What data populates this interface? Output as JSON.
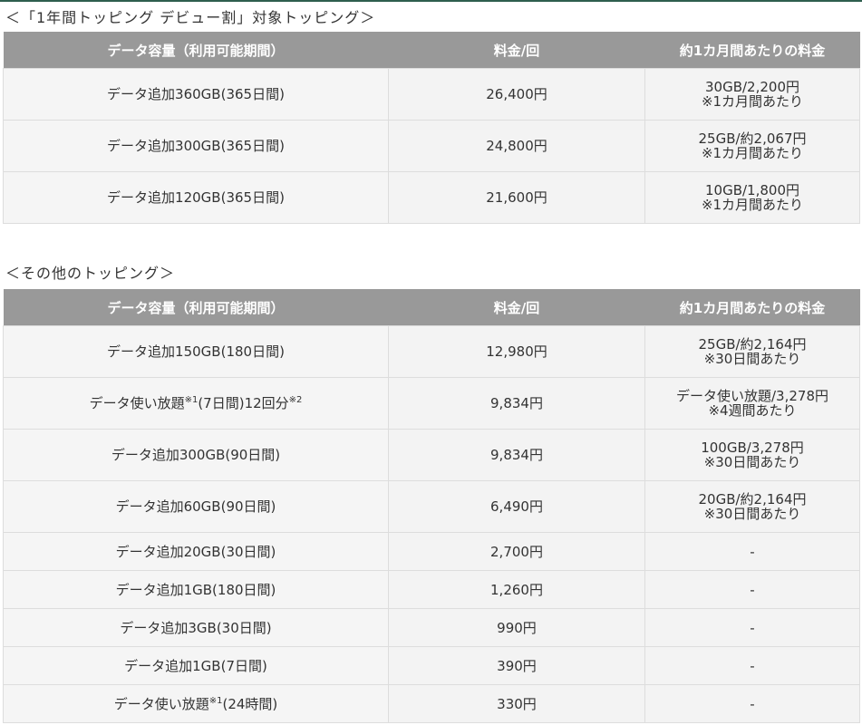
{
  "section1": {
    "title": "＜「1年間トッピング デビュー割」対象トッピング＞",
    "headers": [
      "データ容量（利用可能期間）",
      "料金/回",
      "約1カ月間あたりの料金"
    ],
    "rows": [
      {
        "name": "データ追加360GB(365日間)",
        "price": "26,400円",
        "monthly": "30GB/2,200円",
        "monthly_note": "※1カ月間あたり"
      },
      {
        "name": "データ追加300GB(365日間)",
        "price": "24,800円",
        "monthly": "25GB/約2,067円",
        "monthly_note": "※1カ月間あたり"
      },
      {
        "name": "データ追加120GB(365日間)",
        "price": "21,600円",
        "monthly": "10GB/1,800円",
        "monthly_note": "※1カ月間あたり"
      }
    ]
  },
  "section2": {
    "title": "＜その他のトッピング＞",
    "headers": [
      "データ容量（利用可能期間）",
      "料金/回",
      "約1カ月間あたりの料金"
    ],
    "rows": [
      {
        "name": "データ追加150GB(180日間)",
        "price": "12,980円",
        "monthly": "25GB/約2,164円",
        "monthly_note": "※30日間あたり"
      },
      {
        "name_a": "データ使い放題",
        "sup_a": "※1",
        "name_b": "(7日間)12回分",
        "sup_b": "※2",
        "price": "9,834円",
        "monthly": "データ使い放題/3,278円",
        "monthly_note": "※4週間あたり"
      },
      {
        "name": "データ追加300GB(90日間)",
        "price": "9,834円",
        "monthly": "100GB/3,278円",
        "monthly_note": "※30日間あたり"
      },
      {
        "name": "データ追加60GB(90日間)",
        "price": "6,490円",
        "monthly": "20GB/約2,164円",
        "monthly_note": "※30日間あたり"
      },
      {
        "name": "データ追加20GB(30日間)",
        "price": "2,700円",
        "monthly": "-"
      },
      {
        "name": "データ追加1GB(180日間)",
        "price": "1,260円",
        "monthly": "-"
      },
      {
        "name": "データ追加3GB(30日間)",
        "price": "990円",
        "monthly": "-"
      },
      {
        "name": "データ追加1GB(7日間)",
        "price": "390円",
        "monthly": "-"
      },
      {
        "name_a": "データ使い放題",
        "sup_a": "※1",
        "name_b": "(24時間)",
        "price": "330円",
        "monthly": "-"
      }
    ]
  }
}
